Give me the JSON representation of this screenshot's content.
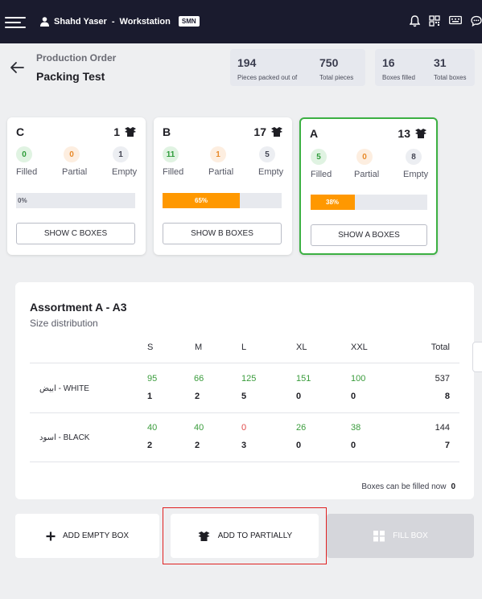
{
  "topbar": {
    "user_name": "Shahd Yaser",
    "separator": "-",
    "workstation_label": "Workstation",
    "workstation_code": "SMN",
    "icons": [
      "bell-icon",
      "qr-code-icon",
      "keyboard-icon",
      "chat-icon"
    ]
  },
  "header": {
    "section_label": "Production Order",
    "title": "Packing Test",
    "stats": {
      "pieces_packed": "194",
      "pieces_packed_label": "Pieces packed out of",
      "total_pieces": "750",
      "total_pieces_label": "Total pieces",
      "boxes_filled": "16",
      "boxes_filled_label": "Boxes filled",
      "total_boxes": "31",
      "total_boxes_label": "Total boxes"
    }
  },
  "cards": [
    {
      "letter": "C",
      "box_count": "1",
      "filled": "0",
      "partial": "0",
      "empty": "1",
      "filled_label": "Filled",
      "partial_label": "Partial",
      "empty_label": "Empty",
      "progress_text": "0%",
      "progress": 0,
      "button_label": "SHOW C BOXES",
      "active": false
    },
    {
      "letter": "B",
      "box_count": "17",
      "filled": "11",
      "partial": "1",
      "empty": "5",
      "filled_label": "Filled",
      "partial_label": "Partial",
      "empty_label": "Empty",
      "progress_text": "65%",
      "progress": 0.65,
      "button_label": "SHOW B BOXES",
      "active": false
    },
    {
      "letter": "A",
      "box_count": "13",
      "filled": "5",
      "partial": "0",
      "empty": "8",
      "filled_label": "Filled",
      "partial_label": "Partial",
      "empty_label": "Empty",
      "progress_text": "38%",
      "progress": 0.38,
      "button_label": "SHOW A BOXES",
      "active": true
    }
  ],
  "assortment": {
    "title": "Assortment A - A3",
    "subtitle": "Size distribution",
    "columns": [
      "S",
      "M",
      "L",
      "XL",
      "XXL",
      "Total"
    ],
    "rows": [
      {
        "name": "ابيض - WHITE",
        "pieces": [
          "95",
          "66",
          "125",
          "151",
          "100",
          "537"
        ],
        "boxes": [
          "1",
          "2",
          "5",
          "0",
          "0",
          "8"
        ]
      },
      {
        "name": "اسود - BLACK",
        "pieces": [
          "40",
          "40",
          "0",
          "26",
          "38",
          "144"
        ],
        "boxes": [
          "2",
          "2",
          "3",
          "0",
          "0",
          "7"
        ]
      }
    ],
    "fill_note_label": "Boxes can be filled now",
    "fill_note_value": "0"
  },
  "actions": {
    "add_empty_label": "ADD EMPTY BOX",
    "add_partially_label": "ADD TO PARTIALLY",
    "fill_box_label": "FILL BOX"
  },
  "colors": {
    "topbar": "#1a1b2e",
    "progress": "#ff9800",
    "active_border": "#3cb043",
    "highlight": "#e02020"
  }
}
